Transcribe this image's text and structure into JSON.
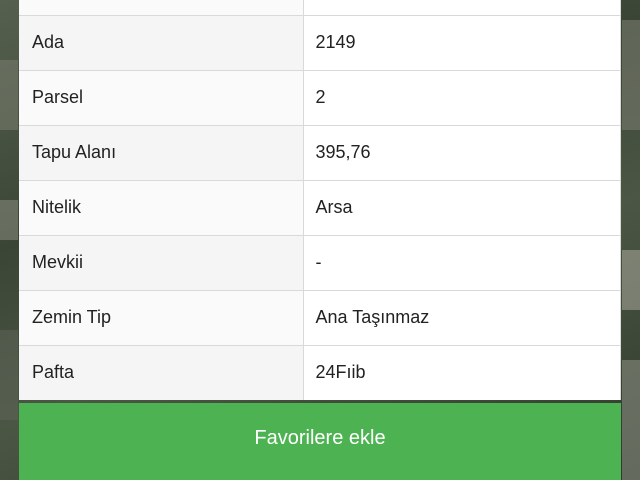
{
  "table": {
    "rows": [
      {
        "label": "",
        "value": ""
      },
      {
        "label": "Ada",
        "value": "2149"
      },
      {
        "label": "Parsel",
        "value": "2"
      },
      {
        "label": "Tapu Alanı",
        "value": "395,76"
      },
      {
        "label": "Nitelik",
        "value": "Arsa"
      },
      {
        "label": "Mevkii",
        "value": "-"
      },
      {
        "label": "Zemin Tip",
        "value": "Ana Taşınmaz"
      },
      {
        "label": "Pafta",
        "value": "24Fıib"
      }
    ]
  },
  "actions": {
    "favorite_label": "Favorilere ekle"
  },
  "colors": {
    "button_green": "#4db352",
    "label_bg": "#f5f5f5",
    "border": "#d9d9d9"
  }
}
